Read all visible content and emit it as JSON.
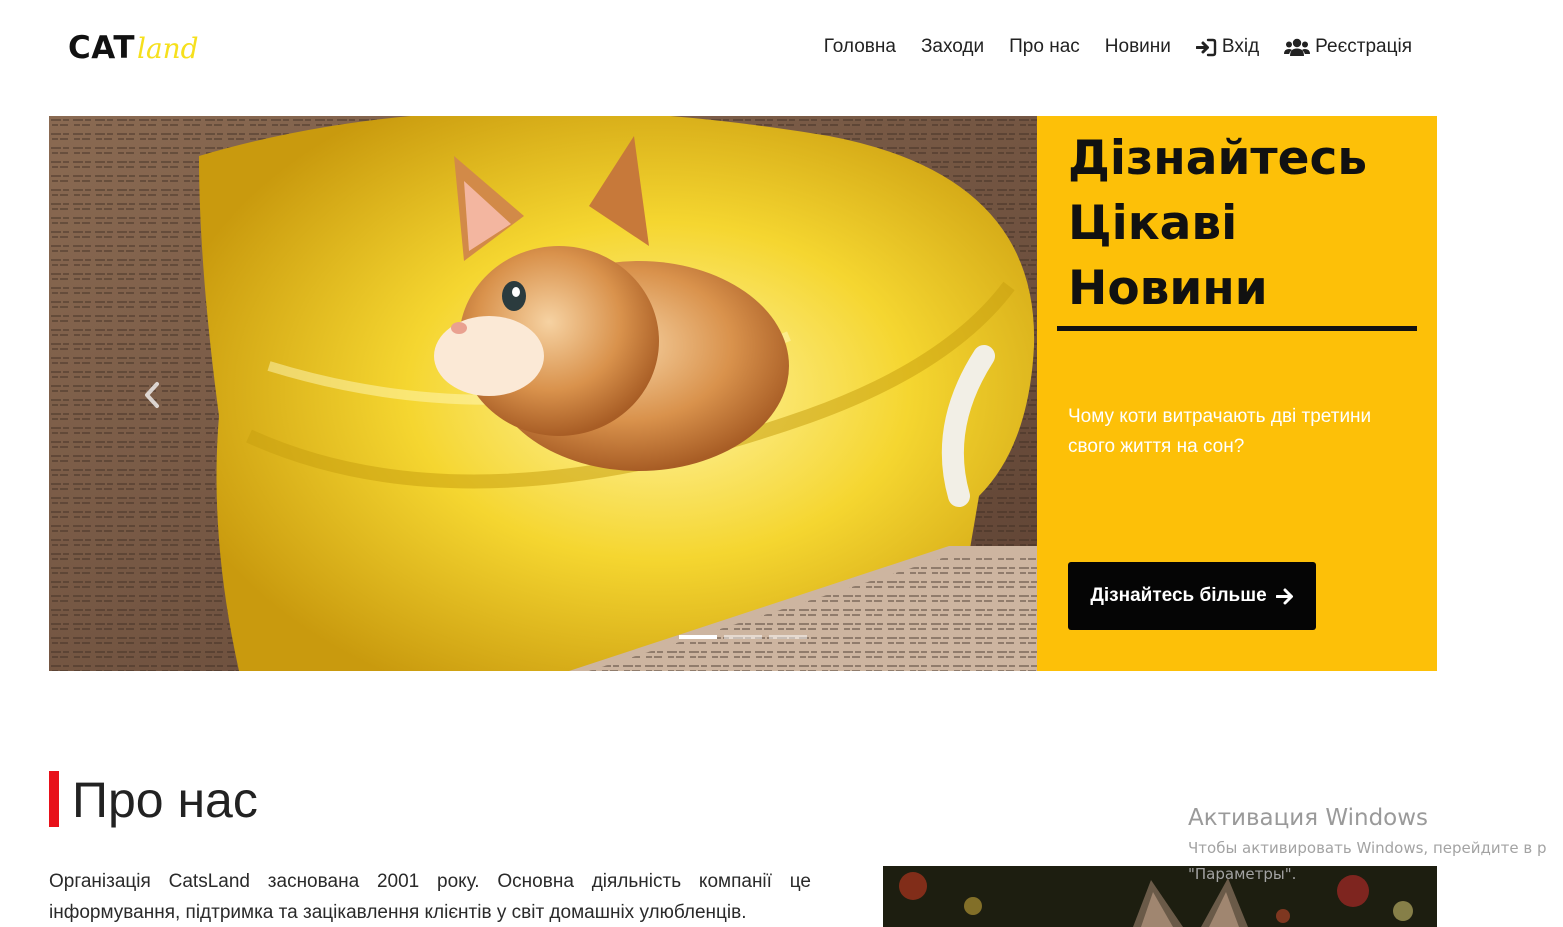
{
  "header": {
    "logo": {
      "main": "CAT",
      "accent": "land"
    },
    "nav": [
      {
        "label": "Головна",
        "icon": ""
      },
      {
        "label": "Заходи",
        "icon": ""
      },
      {
        "label": "Про нас",
        "icon": ""
      },
      {
        "label": "Новини",
        "icon": ""
      },
      {
        "label": "Вхід",
        "icon": "sign-in-icon"
      },
      {
        "label": "Реєстрація",
        "icon": "users-icon"
      }
    ]
  },
  "hero": {
    "title": "Дізнайтесь Цікаві Новини",
    "subtitle": "Чому коти витрачають дві третини свого життя на сон?",
    "cta_label": "Дізнайтесь більше",
    "cta_icon": "arrow-right-icon",
    "slides_count": 3,
    "active_slide": 1,
    "photo": "orange kitten sitting in a yellow burlap sack"
  },
  "about": {
    "title": "Про нас",
    "text": "Організація CatsLand заснована 2001 року. Основна діяльність компанії це інформування, підтримка та зацікавлення клієнтів у світ домашніх улюбленців."
  },
  "watermark": {
    "title": "Активация Windows",
    "line1": "Чтобы активировать Windows, перейдите в р",
    "line2": "\"Параметры\"."
  },
  "colors": {
    "accent_yellow": "#fdc008",
    "logo_yellow": "#f6e01c",
    "about_bar_red": "#e8111a",
    "button_black": "#050505"
  }
}
